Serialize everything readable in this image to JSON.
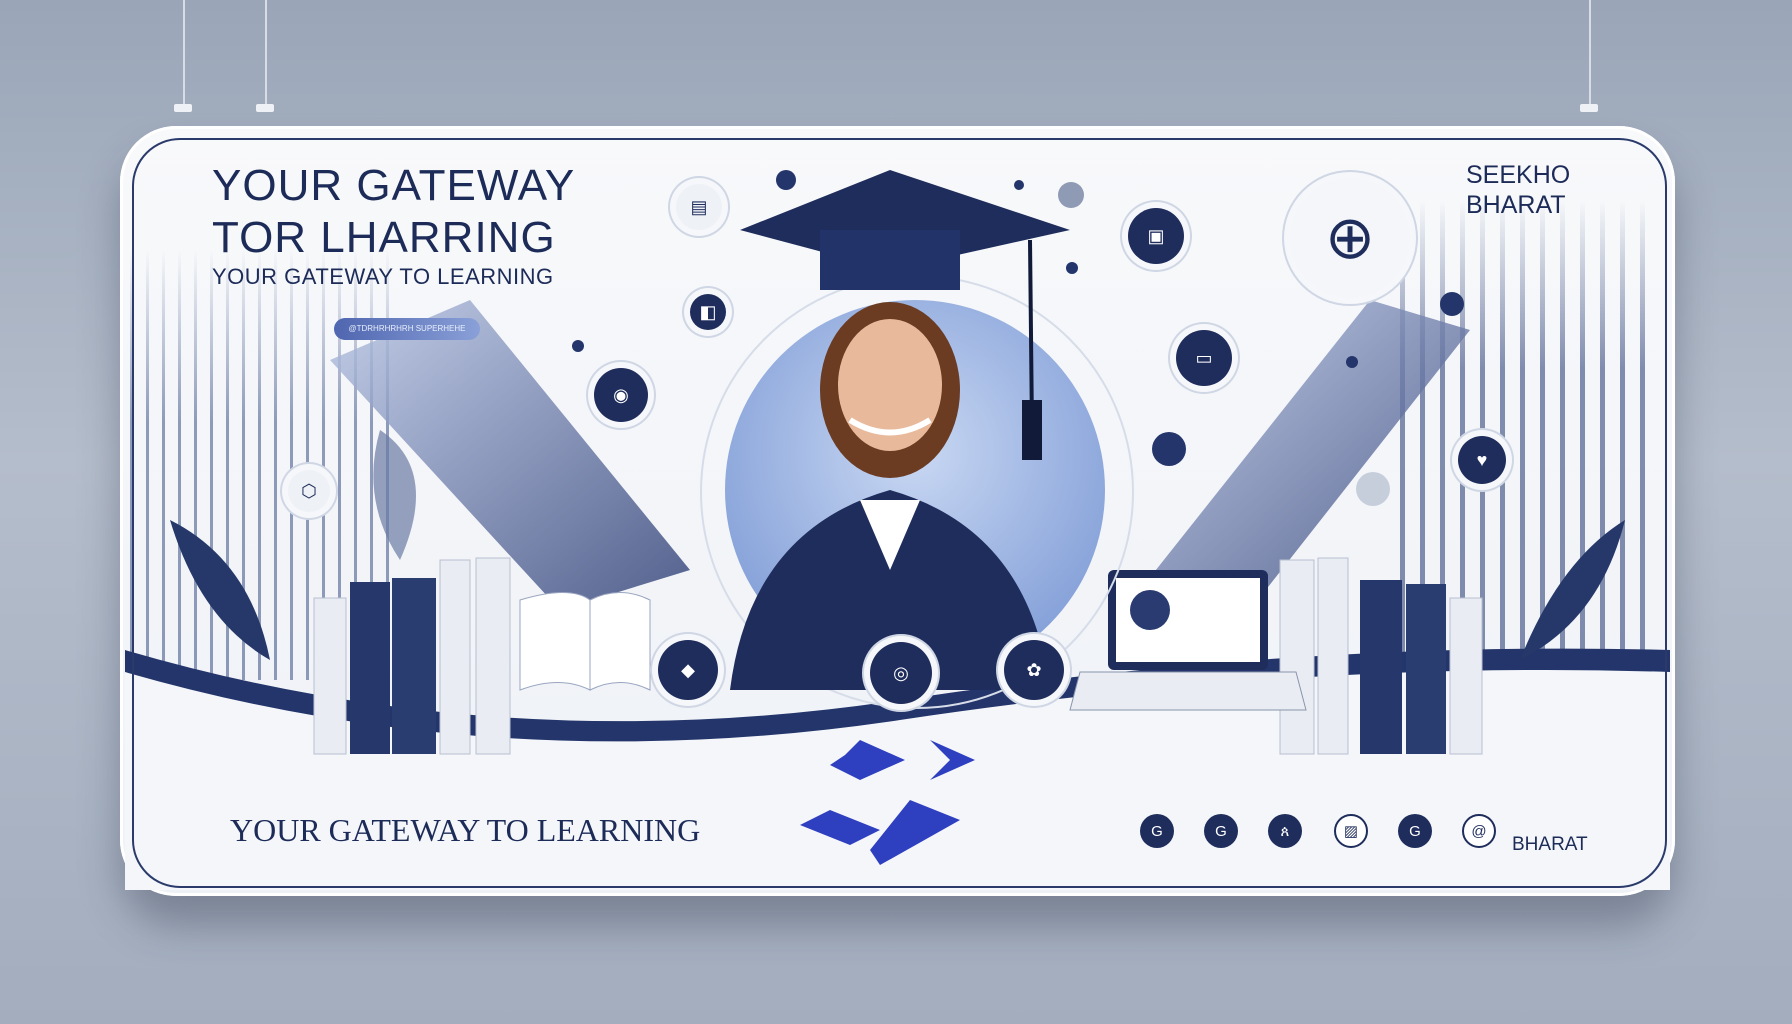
{
  "banner": {
    "headline": "YOUR GATEWAY TOR LHARRING",
    "subheadline": "YOUR GATEWAY TO LEARNING",
    "pill_text": "@TDRHRHRHRH SUPERHEHE",
    "brand_line1": "SEEKHO",
    "brand_line2": "BHARAT",
    "bottom_tagline": "YOUR GATEWAY TO LEARNING",
    "bottom_brand": "BHARAT"
  },
  "icons": {
    "feature_icons": [
      "book-icon",
      "bookmark-icon",
      "monitor-icon",
      "laptop-icon",
      "globe-icon",
      "chat-heart-icon",
      "lock-icon",
      "shield-icon",
      "camera-icon",
      "palette-icon",
      "badge-icon"
    ],
    "social_icons": [
      "g-icon",
      "g-alt-icon",
      "user-icon",
      "image-icon",
      "g-circle-icon",
      "swirl-icon"
    ]
  },
  "colors": {
    "navy": "#1f2d5c",
    "accent_blue": "#2e3fbf",
    "background": "#f4f6fa"
  }
}
